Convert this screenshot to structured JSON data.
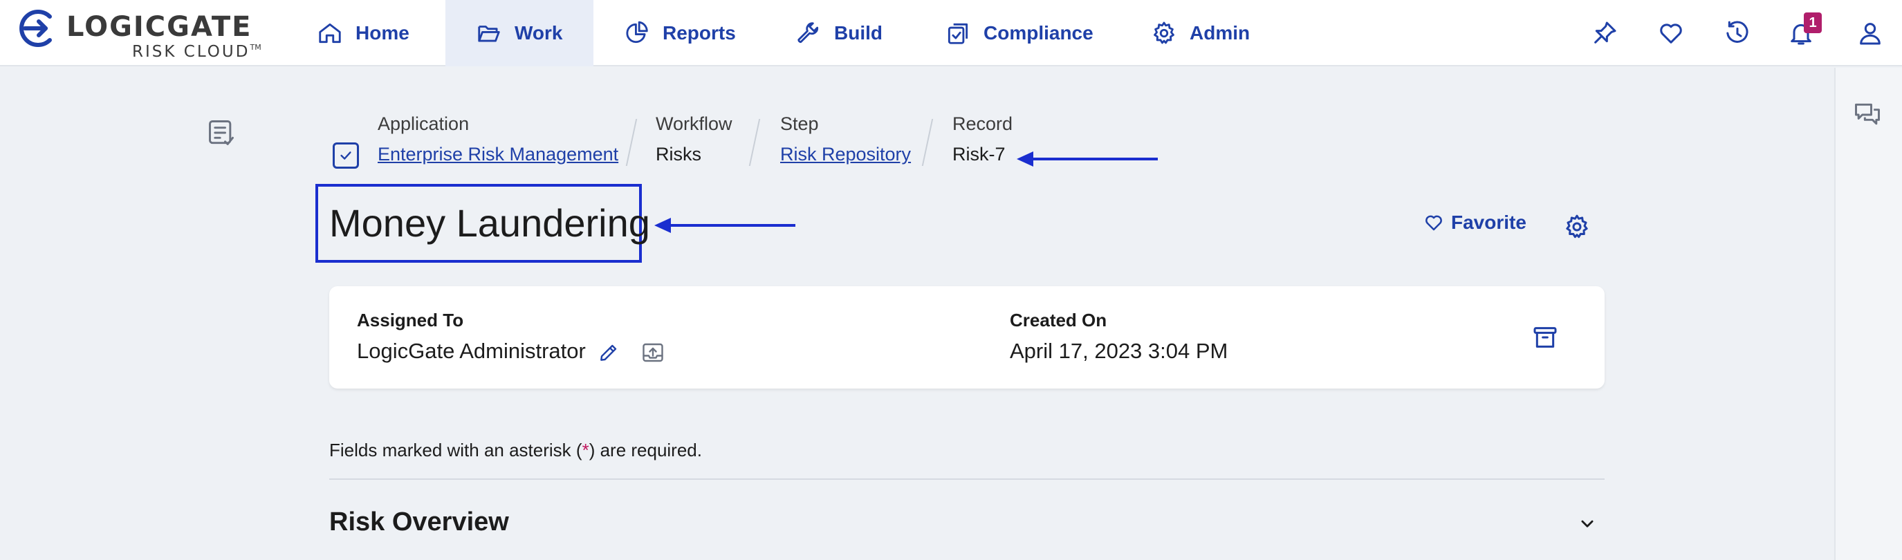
{
  "brand": {
    "name": "LOGICGATE",
    "sub": "RISK CLOUD",
    "tm": "TM"
  },
  "nav": {
    "home": "Home",
    "work": "Work",
    "reports": "Reports",
    "build": "Build",
    "compliance": "Compliance",
    "admin": "Admin",
    "active": "Work"
  },
  "notifications": {
    "count": "1"
  },
  "breadcrumb": {
    "application_label": "Application",
    "application_value": "Enterprise Risk Management",
    "workflow_label": "Workflow",
    "workflow_value": "Risks",
    "step_label": "Step",
    "step_value": "Risk Repository",
    "record_label": "Record",
    "record_value": "Risk-7"
  },
  "record": {
    "title": "Money Laundering",
    "favorite_label": "Favorite",
    "assigned_to_label": "Assigned To",
    "assigned_to_value": "LogicGate Administrator",
    "created_on_label": "Created On",
    "created_on_value": "April 17, 2023 3:04 PM"
  },
  "form": {
    "required_note_prefix": "Fields marked with an asterisk (",
    "required_note_asterisk": "*",
    "required_note_suffix": ") are required."
  },
  "sections": [
    {
      "title": "Risk Overview"
    }
  ],
  "colors": {
    "accent": "#1f40a8",
    "annotation": "#1a2ecf",
    "badge": "#b01e6b"
  }
}
